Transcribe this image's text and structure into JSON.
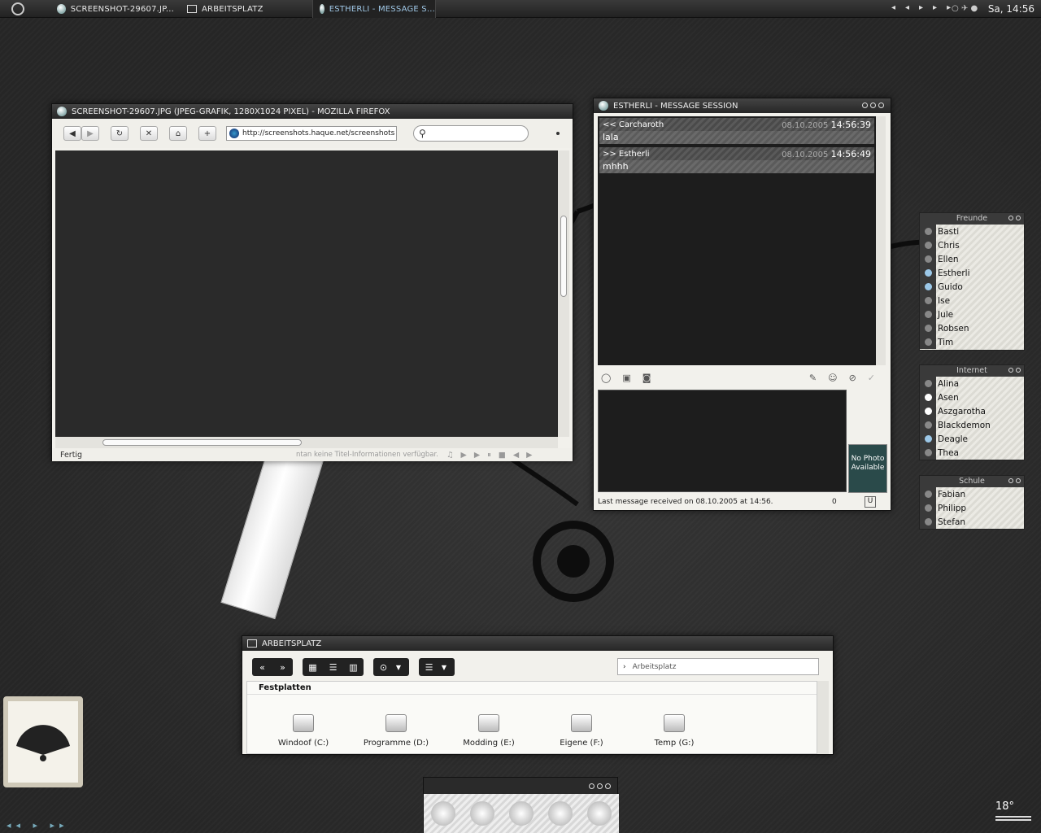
{
  "taskbar": {
    "tasks": [
      "SCREENSHOT-29607.JP...",
      "ARBEITSPLATZ",
      "ESTHERLI - MESSAGE S..."
    ],
    "clock": "Sa, 14:56"
  },
  "firefox": {
    "title": "SCREENSHOT-29607.JPG (JPEG-GRAFIK, 1280X1024 PIXEL) - MOZILLA FIREFOX",
    "url": "http://screenshots.haque.net/screenshots",
    "status": "Fertig",
    "status_info": "ntan keine Titel-Informationen verfügbar."
  },
  "chat": {
    "title": "ESTHERLI - MESSAGE SESSION",
    "messages": [
      {
        "from": "<< Carcharoth",
        "date": "08.10.2005",
        "time": "14:56:39",
        "text": "lala"
      },
      {
        "from": ">> Estherli",
        "date": "08.10.2005",
        "time": "14:56:49",
        "text": "mhhh"
      }
    ],
    "photo": "No Photo Available",
    "status": "Last message received on 08.10.2005 at 14:56.",
    "count": "0",
    "u_label": "U"
  },
  "buddies": {
    "groups": [
      {
        "name": "Freunde",
        "members": [
          "Basti",
          "Chris",
          "Ellen",
          "Estherli",
          "Guido",
          "Ise",
          "Jule",
          "Robsen",
          "Tim"
        ]
      },
      {
        "name": "Internet",
        "members": [
          "Alina",
          "Asen",
          "Aszgarotha",
          "Blackdemon",
          "Deagle",
          "Thea"
        ]
      },
      {
        "name": "Schule",
        "members": [
          "Fabian",
          "Philipp",
          "Stefan"
        ]
      }
    ]
  },
  "explorer": {
    "title": "ARBEITSPLATZ",
    "location": "Arbeitsplatz",
    "section": "Festplatten",
    "drives": [
      "Windoof (C:)",
      "Programme (D:)",
      "Modding (E:)",
      "Eigene (F:)",
      "Temp (G:)"
    ]
  },
  "weather": {
    "temp": "18°"
  }
}
